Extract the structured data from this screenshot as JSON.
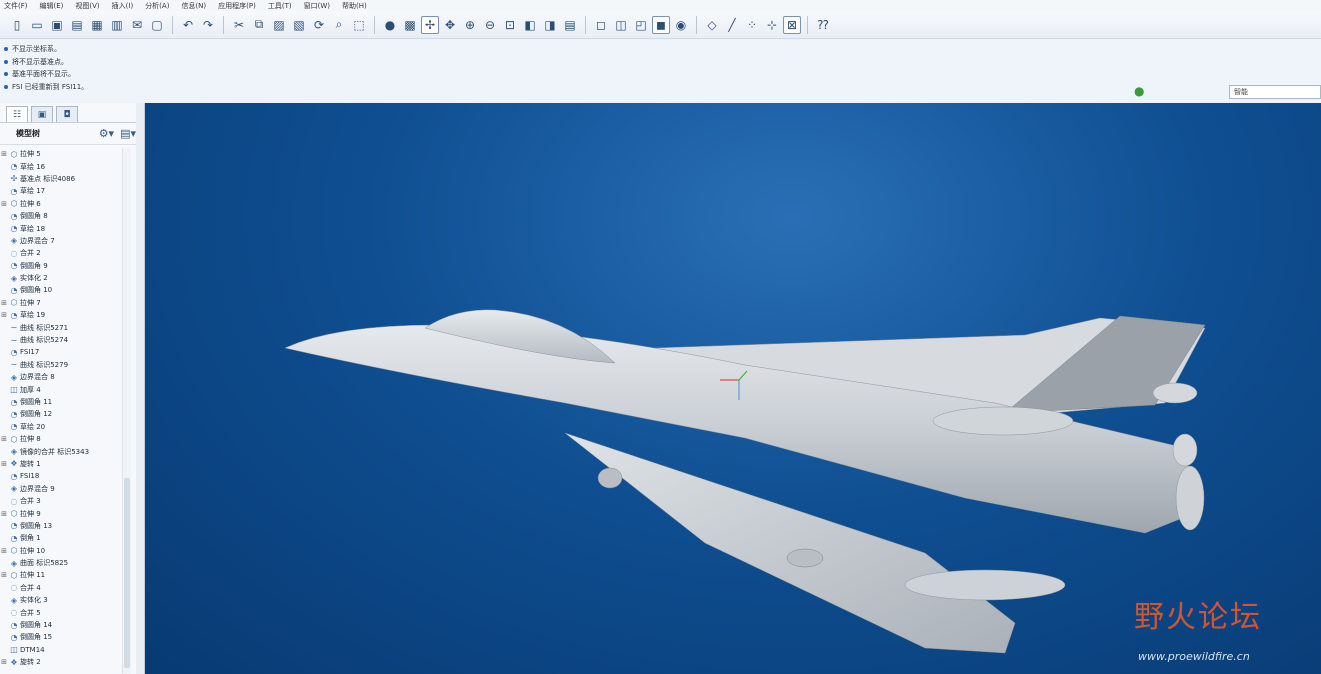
{
  "menu": [
    "文件(F)",
    "编辑(E)",
    "视图(V)",
    "插入(I)",
    "分析(A)",
    "信息(N)",
    "应用程序(P)",
    "工具(T)",
    "窗口(W)",
    "帮助(H)"
  ],
  "toolbar_icons": [
    "new-file-icon",
    "open-folder-icon",
    "save-icon",
    "save-as-icon",
    "print-icon",
    "print-setup-icon",
    "email-icon",
    "close-window-icon",
    "sep",
    "undo-icon",
    "redo-icon",
    "sep",
    "cut-icon",
    "copy-icon",
    "paste-icon",
    "paste-special-icon",
    "regenerate-icon",
    "find-icon",
    "select-box-icon",
    "sep",
    "shading-icon",
    "repaint-icon",
    "spin-center-icon",
    "orient-icon",
    "zoom-in-icon",
    "zoom-out-icon",
    "refit-icon",
    "named-view-icon",
    "view-manager-icon",
    "layers-icon",
    "sep",
    "wireframe-icon",
    "hidden-line-icon",
    "no-hidden-icon",
    "shading-mode-icon",
    "enhanced-realism-icon",
    "sep",
    "datum-plane-icon",
    "datum-axis-icon",
    "datum-point-icon",
    "coordinate-system-icon",
    "annotation-icon",
    "sep",
    "help-icon"
  ],
  "messages": [
    "不显示坐标系。",
    "将不显示基准点。",
    "基准平面将不显示。",
    "FSI 已经重新到 FSI11。"
  ],
  "filter_value": "智能",
  "panel": {
    "title": "模型树"
  },
  "tree": [
    {
      "exp": "⊞",
      "icon": "⬡",
      "label": "拉伸 5"
    },
    {
      "exp": "",
      "icon": "◔",
      "label": "草绘 16"
    },
    {
      "exp": "",
      "icon": "✣",
      "label": "基准点 标识4086"
    },
    {
      "exp": "",
      "icon": "◔",
      "label": "草绘 17"
    },
    {
      "exp": "⊞",
      "icon": "⬡",
      "label": "拉伸 6"
    },
    {
      "exp": "",
      "icon": "◔",
      "label": "倒圆角 8"
    },
    {
      "exp": "",
      "icon": "◔",
      "label": "草绘 18"
    },
    {
      "exp": "",
      "icon": "◈",
      "label": "边界混合 7"
    },
    {
      "exp": "",
      "icon": "◌",
      "label": "合并 2"
    },
    {
      "exp": "",
      "icon": "◔",
      "label": "倒圆角 9"
    },
    {
      "exp": "",
      "icon": "◈",
      "label": "实体化 2"
    },
    {
      "exp": "",
      "icon": "◔",
      "label": "倒圆角 10"
    },
    {
      "exp": "⊞",
      "icon": "⬡",
      "label": "拉伸 7"
    },
    {
      "exp": "⊞",
      "icon": "◔",
      "label": "草绘 19"
    },
    {
      "exp": "",
      "icon": "∼",
      "label": "曲线 标识5271"
    },
    {
      "exp": "",
      "icon": "∼",
      "label": "曲线 标识5274"
    },
    {
      "exp": "",
      "icon": "◔",
      "label": "FSI17"
    },
    {
      "exp": "",
      "icon": "∼",
      "label": "曲线 标识5279"
    },
    {
      "exp": "",
      "icon": "◈",
      "label": "边界混合 8"
    },
    {
      "exp": "",
      "icon": "◫",
      "label": "加厚 4"
    },
    {
      "exp": "",
      "icon": "◔",
      "label": "倒圆角 11"
    },
    {
      "exp": "",
      "icon": "◔",
      "label": "倒圆角 12"
    },
    {
      "exp": "",
      "icon": "◔",
      "label": "草绘 20"
    },
    {
      "exp": "⊞",
      "icon": "⬡",
      "label": "拉伸 8"
    },
    {
      "exp": "",
      "icon": "◈",
      "label": "镜像的合并 标识5343"
    },
    {
      "exp": "⊞",
      "icon": "❖",
      "label": "旋转 1"
    },
    {
      "exp": "",
      "icon": "◔",
      "label": "FSI18"
    },
    {
      "exp": "",
      "icon": "◈",
      "label": "边界混合 9"
    },
    {
      "exp": "",
      "icon": "◌",
      "label": "合并 3"
    },
    {
      "exp": "⊞",
      "icon": "⬡",
      "label": "拉伸 9"
    },
    {
      "exp": "",
      "icon": "◔",
      "label": "倒圆角 13"
    },
    {
      "exp": "",
      "icon": "◔",
      "label": "倒角 1"
    },
    {
      "exp": "⊞",
      "icon": "⬡",
      "label": "拉伸 10"
    },
    {
      "exp": "",
      "icon": "◈",
      "label": "曲面 标识5825"
    },
    {
      "exp": "⊞",
      "icon": "⬡",
      "label": "拉伸 11"
    },
    {
      "exp": "",
      "icon": "◌",
      "label": "合并 4"
    },
    {
      "exp": "",
      "icon": "◈",
      "label": "实体化 3"
    },
    {
      "exp": "",
      "icon": "◌",
      "label": "合并 5"
    },
    {
      "exp": "",
      "icon": "◔",
      "label": "倒圆角 14"
    },
    {
      "exp": "",
      "icon": "◔",
      "label": "倒圆角 15"
    },
    {
      "exp": "",
      "icon": "◫",
      "label": "DTM14"
    },
    {
      "exp": "⊞",
      "icon": "❖",
      "label": "旋转 2"
    }
  ],
  "watermark": {
    "cn": "野火论坛",
    "url": "www.proewildfire.cn"
  }
}
